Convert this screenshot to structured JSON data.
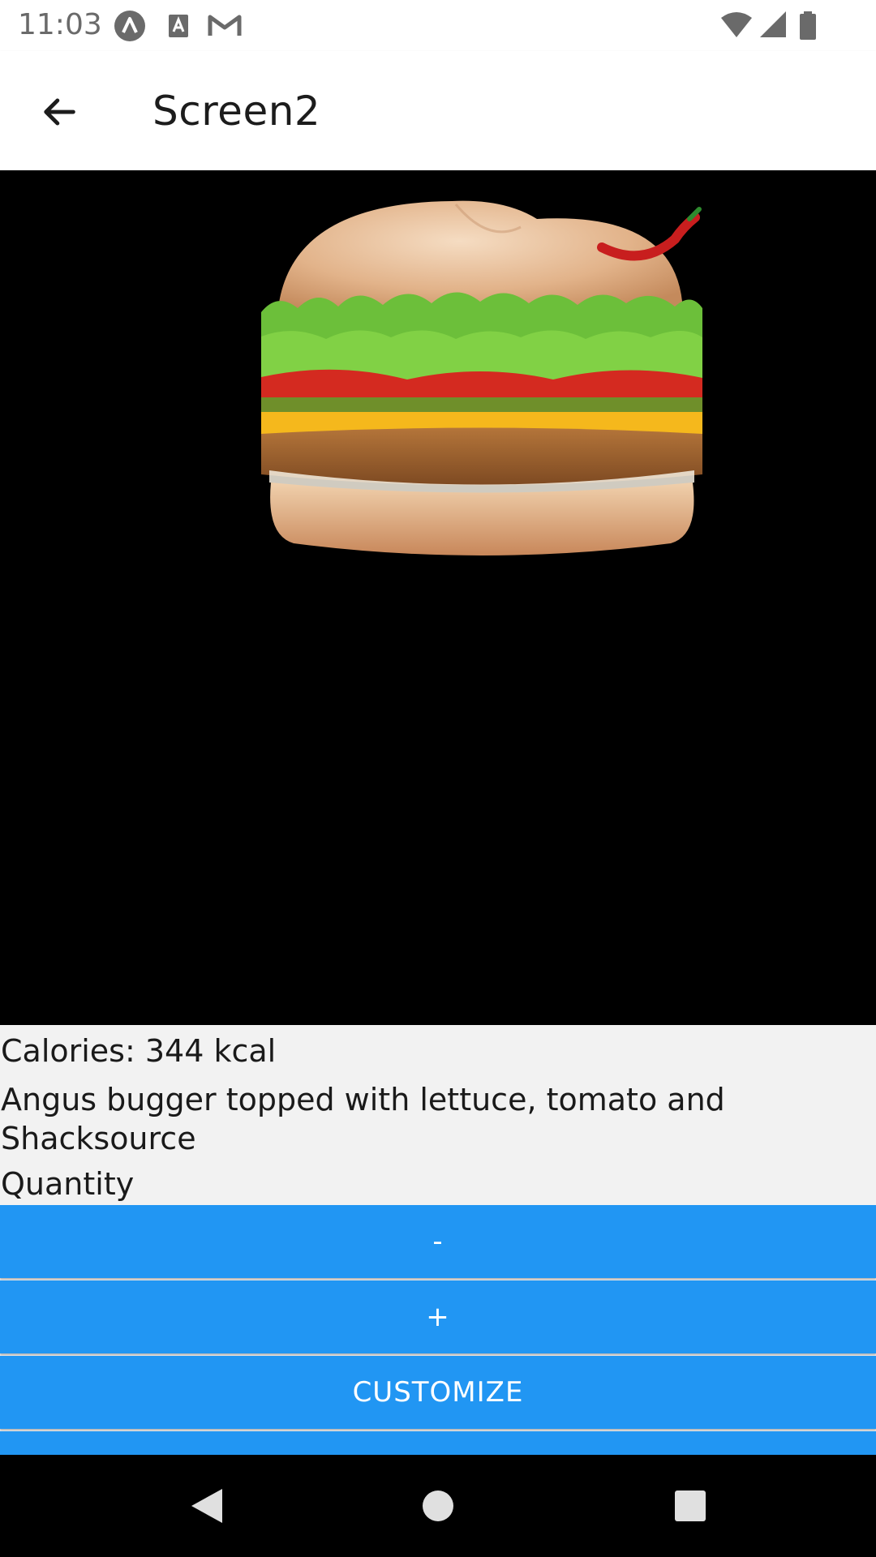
{
  "status_bar": {
    "time": "11:03",
    "left_icons": [
      "notification-a-icon",
      "text-a-icon",
      "gmail-icon"
    ],
    "right_icons": [
      "wifi-icon",
      "cell-signal-icon",
      "battery-icon"
    ]
  },
  "app_bar": {
    "title": "Screen2",
    "back_icon": "arrow-back-icon"
  },
  "product": {
    "image": "burger-image",
    "calories": "Calories: 344 kcal",
    "description": "Angus bugger topped with lettuce, tomato and Shacksource",
    "quantity_label": "Quantity"
  },
  "buttons": {
    "minus": "-",
    "plus": "+",
    "customize": "CUSTOMIZE"
  },
  "colors": {
    "accent": "#2196f3",
    "image_background": "#000000",
    "page_background": "#f2f2f2"
  },
  "nav_bar": {
    "icons": [
      "nav-back-icon",
      "nav-home-icon",
      "nav-recents-icon"
    ]
  }
}
